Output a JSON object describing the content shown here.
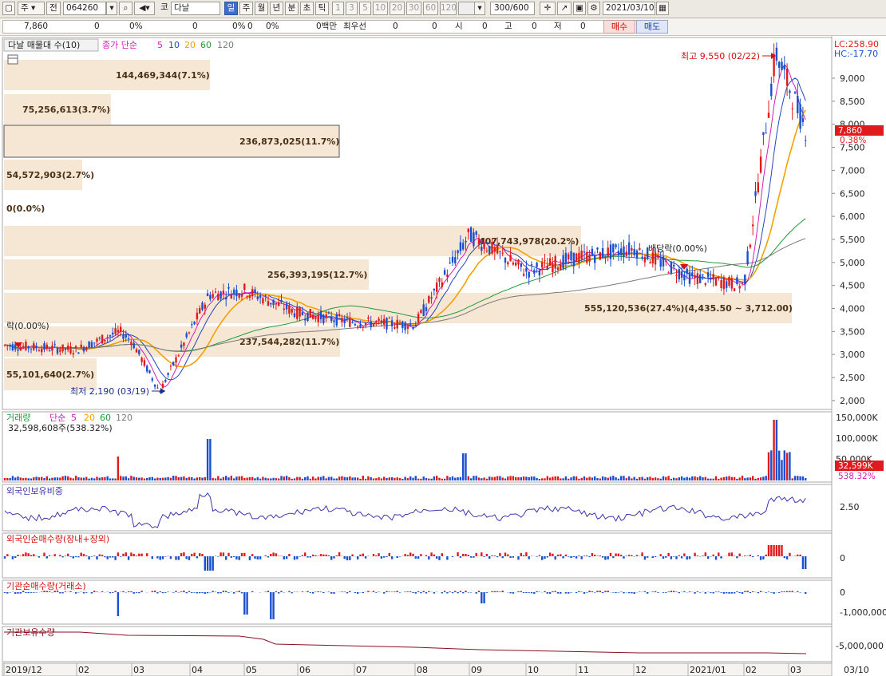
{
  "toolbar": {
    "market": "주",
    "prev": "전",
    "code": "064260",
    "code_prefix": "코",
    "name": "다날",
    "periods": [
      "일",
      "주",
      "월",
      "년",
      "분",
      "초",
      "틱"
    ],
    "active_period": "일",
    "ticks": [
      "1",
      "3",
      "5",
      "10",
      "20",
      "30",
      "60",
      "120"
    ],
    "count": "300",
    "total": "/600",
    "date": "2021/03/10"
  },
  "infobar": {
    "price": "7,860",
    "v1": "0",
    "p1": "0%",
    "v2": "0",
    "p2": "0%",
    "v3": "0",
    "p3": "0%",
    "amount": "0백만",
    "priority_label": "최우선",
    "pv1": "0",
    "pv2": "0",
    "o_label": "시",
    "o": "0",
    "h_label": "고",
    "h": "0",
    "l_label": "저",
    "l": "0",
    "buy": "매수",
    "sell": "매도"
  },
  "price_panel": {
    "title": "다날 매물대 수(10)",
    "ma_label": "종가 단순",
    "ma_periods": [
      "5",
      "10",
      "20",
      "60",
      "120"
    ],
    "lc": "LC:258.90",
    "hc": "HC:-17.70",
    "cur_price": "7,860",
    "cur_pct": "0.38%",
    "high_label": "최고 9,550 (02/22)",
    "low_label": "최저 2,190 (03/19)",
    "note_left": "락(0.00%)",
    "note_mid": "배당락(0.00%)",
    "zero_label": "0(0.0%)",
    "y_ticks": [
      "9,000",
      "8,500",
      "8,000",
      "7,500",
      "7,000",
      "6,500",
      "6,000",
      "5,500",
      "5,000",
      "4,500",
      "4,000",
      "3,500",
      "3,000",
      "2,500",
      "2,000"
    ]
  },
  "volume_profile": [
    {
      "label": "144,469,344(7.1%)"
    },
    {
      "label": "75,256,613(3.7%)"
    },
    {
      "label": "236,873,025(11.7%)"
    },
    {
      "label": "54,572,903(2.7%)"
    },
    {
      "label": "0(0.0%)"
    },
    {
      "label": "407,743,978(20.2%)"
    },
    {
      "label": "256,393,195(12.7%)"
    },
    {
      "label": "555,120,536(27.4%)(4,435.50 ~ 3,712.00)"
    },
    {
      "label": "237,544,282(11.7%)"
    },
    {
      "label": "55,101,640(2.7%)"
    }
  ],
  "volume_panel": {
    "title": "거래량",
    "ma_label": "단순",
    "ma_periods": [
      "5",
      "20",
      "60",
      "120"
    ],
    "summary": "32,598,608주(538.32%)",
    "badge_value": "32,599K",
    "badge_pct": "538.32%",
    "y_ticks": [
      "150,000K",
      "100,000K",
      "50,000K"
    ]
  },
  "foreign_ratio_panel": {
    "title": "외국인보유비중",
    "y_ticks": [
      "2.50"
    ]
  },
  "foreign_net_panel": {
    "title": "외국인순매수량(장내+장외)",
    "y_ticks": [
      "0"
    ]
  },
  "inst_net_panel": {
    "title": "기관순매수량(거래소)",
    "y_ticks": [
      "0",
      "-1,000,000"
    ]
  },
  "inst_hold_panel": {
    "title": "기관보유수량",
    "y_ticks": [
      "-5,000,000"
    ]
  },
  "x_axis": {
    "labels": [
      "2019/12",
      "02",
      "03",
      "04",
      "05",
      "06",
      "07",
      "08",
      "09",
      "10",
      "11",
      "12",
      "2021/01",
      "02",
      "03"
    ],
    "right_label": "03/10"
  },
  "colors": {
    "up": "#e01b1b",
    "down": "#1a4fd0",
    "ma5": "#d11fb4",
    "ma10": "#2645b8",
    "ma20": "#f2a100",
    "ma60": "#1f9a3a",
    "ma120": "#7a7a7a",
    "profile": "#f6e7d4",
    "annotation": "#d40f0f"
  },
  "chart_data": {
    "type": "candlestick",
    "title": "다날 매물대 수(10)",
    "x_range": [
      "2019/12",
      "2021/03/10"
    ],
    "ylim": [
      2000,
      9550
    ],
    "legend": [
      "종가 단순 5",
      "10",
      "20",
      "60",
      "120"
    ],
    "close_points": [
      {
        "x": "2019/12",
        "y": 3200
      },
      {
        "x": "02",
        "y": 3100
      },
      {
        "x": "02 end",
        "y": 3500
      },
      {
        "x": "03",
        "y": 3300
      },
      {
        "x": "03/19",
        "y": 2190
      },
      {
        "x": "04",
        "y": 3500
      },
      {
        "x": "04 mid",
        "y": 4300
      },
      {
        "x": "05",
        "y": 4400
      },
      {
        "x": "06",
        "y": 3900
      },
      {
        "x": "07",
        "y": 3700
      },
      {
        "x": "08",
        "y": 3650
      },
      {
        "x": "09",
        "y": 5600
      },
      {
        "x": "10",
        "y": 4800
      },
      {
        "x": "11",
        "y": 5100
      },
      {
        "x": "12",
        "y": 5300
      },
      {
        "x": "2021/01",
        "y": 4700
      },
      {
        "x": "02",
        "y": 4500
      },
      {
        "x": "02/22",
        "y": 9550
      },
      {
        "x": "03/10",
        "y": 7860
      }
    ],
    "volume_profile_pct": [
      7.1,
      3.7,
      11.7,
      2.7,
      0.0,
      20.2,
      12.7,
      27.4,
      11.7,
      2.7
    ],
    "last_volume": "32,598,608"
  }
}
